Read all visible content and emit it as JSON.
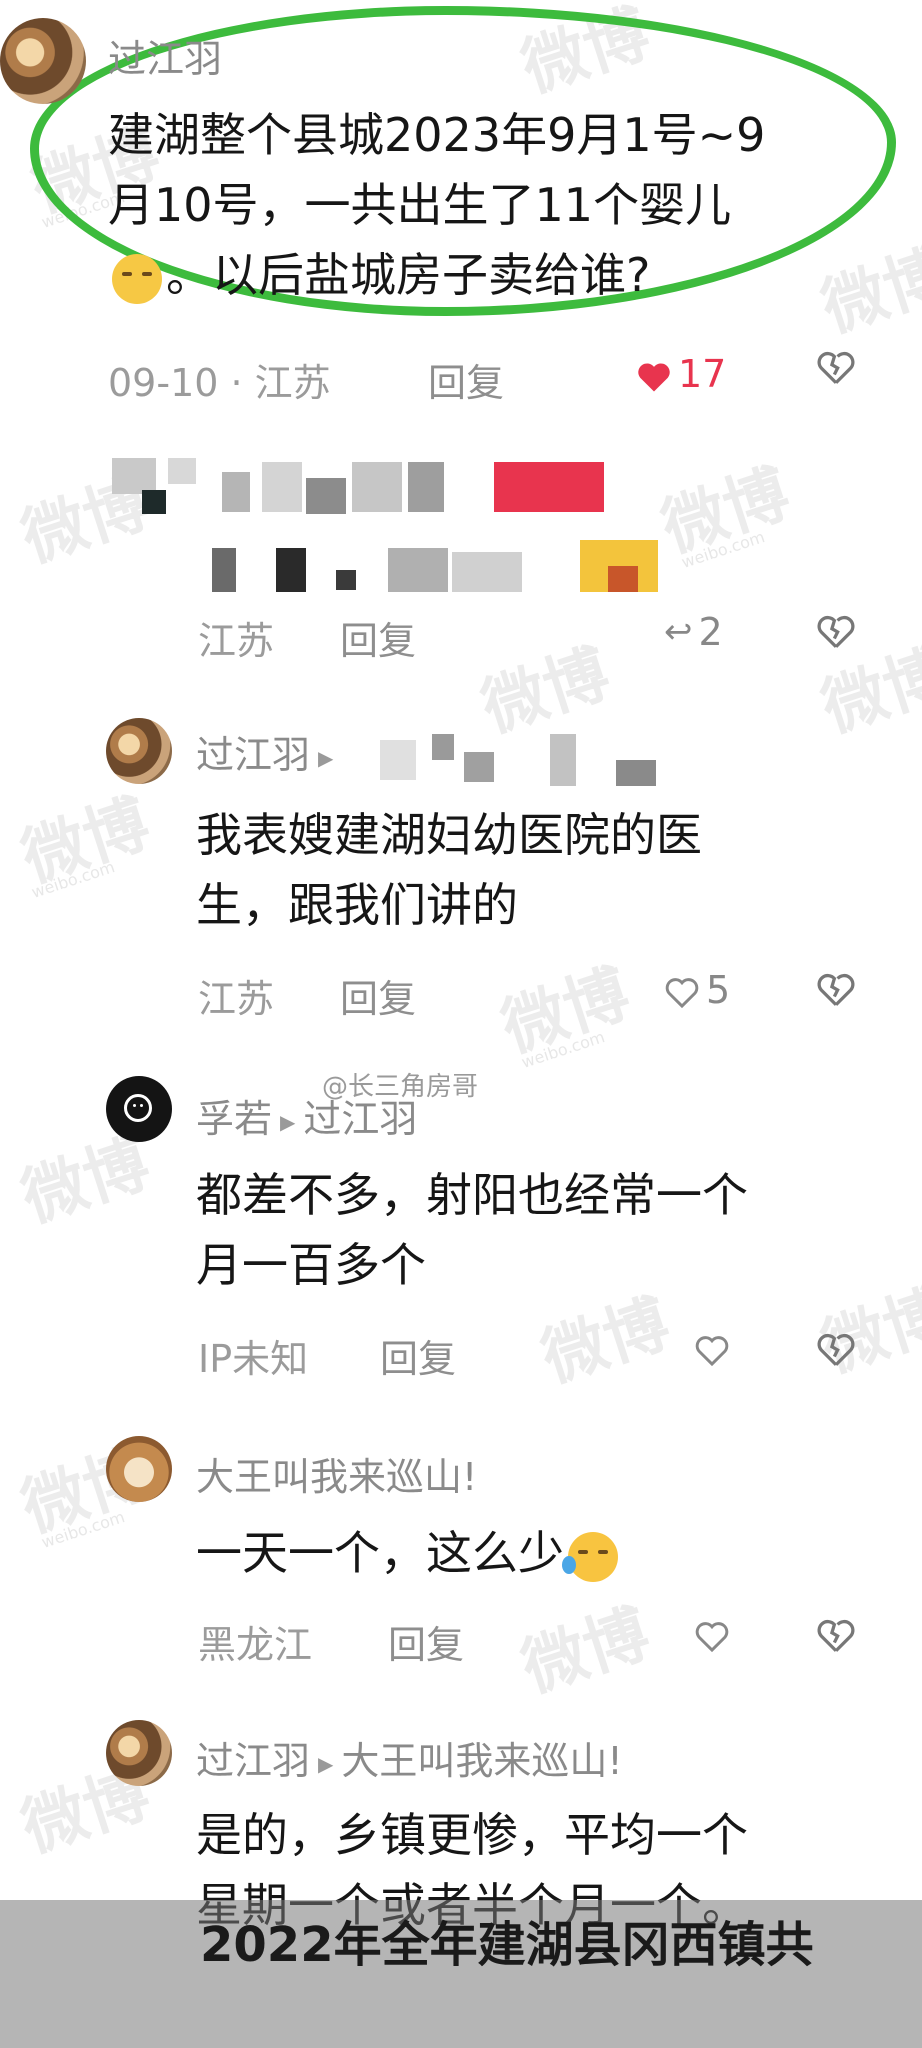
{
  "comments": [
    {
      "name": "过江羽",
      "text_lines": [
        "建湖整个县城2023年9月1号~9",
        "月10号，一共出生了11个婴儿",
        "。以后盐城房子卖给谁?"
      ],
      "date": "09-10",
      "location": "江苏",
      "reply": "回复",
      "likes": "17"
    },
    {
      "location": "江苏",
      "reply": "回复",
      "replies_count": "2"
    },
    {
      "name": "过江羽",
      "text_lines": [
        "我表嫂建湖妇幼医院的医",
        "生，跟我们讲的"
      ],
      "location": "江苏",
      "reply": "回复",
      "likes": "5"
    },
    {
      "name": "孚若",
      "reply_to": "过江羽",
      "text_lines": [
        "都差不多，射阳也经常一个",
        "月一百多个"
      ],
      "location": "IP未知",
      "reply": "回复"
    },
    {
      "name": "大王叫我来巡山!",
      "text_lines": [
        "一天一个，这么少"
      ],
      "location": "黑龙江",
      "reply": "回复"
    },
    {
      "name": "过江羽",
      "reply_to": "大王叫我来巡山!",
      "text_lines": [
        "是的，乡镇更惨，平均一个",
        "星期一个或者半个月一个。"
      ]
    }
  ],
  "source_tag": "@长三角房哥",
  "watermark": {
    "main": "微博",
    "sub": "weibo.com"
  },
  "overlay_text": "2022年全年建湖县冈西镇共",
  "colors": {
    "accent_green": "#3dbb3d",
    "like_red": "#e8344e"
  }
}
